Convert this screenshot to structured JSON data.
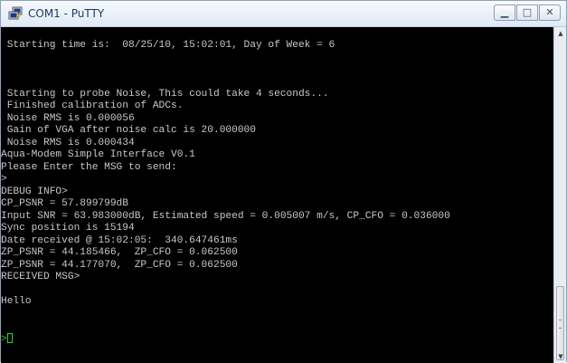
{
  "window": {
    "title": "COM1 - PuTTY",
    "icon": "putty-terminal-icon",
    "minimize_glyph": "▁",
    "maximize_glyph": "□",
    "close_glyph": "✕"
  },
  "terminal": {
    "lines": [
      "",
      " Starting time is:  08/25/10, 15:02:01, Day of Week = 6",
      "",
      "",
      "",
      " Starting to probe Noise, This could take 4 seconds...",
      " Finished calibration of ADCs.",
      " Noise RMS is 0.000056",
      " Gain of VGA after noise calc is 20.000000",
      " Noise RMS is 0.000434",
      "Aqua-Modem Simple Interface V0.1",
      "Please Enter the MSG to send:",
      ">",
      "DEBUG INFO>",
      "CP_PSNR = 57.899799dB",
      "Input SNR = 63.983000dB, Estimated speed = 0.005007 m/s, CP_CFO = 0.036000",
      "Sync position is 15194",
      "Date received @ 15:02:05:  340.647461ms",
      "ZP_PSNR = 44.185466,  ZP_CFO = 0.062500",
      "ZP_PSNR = 44.177070,  ZP_CFO = 0.062500",
      "RECEIVED MSG>",
      "",
      "Hello",
      "",
      ""
    ],
    "prompt": ">",
    "colors": {
      "background": "#000000",
      "text": "#c8c8c8",
      "cursor": "#37d137"
    }
  },
  "scrollbar": {
    "up_glyph": "▲",
    "down_glyph": "▼",
    "position_fraction": 1.0
  }
}
